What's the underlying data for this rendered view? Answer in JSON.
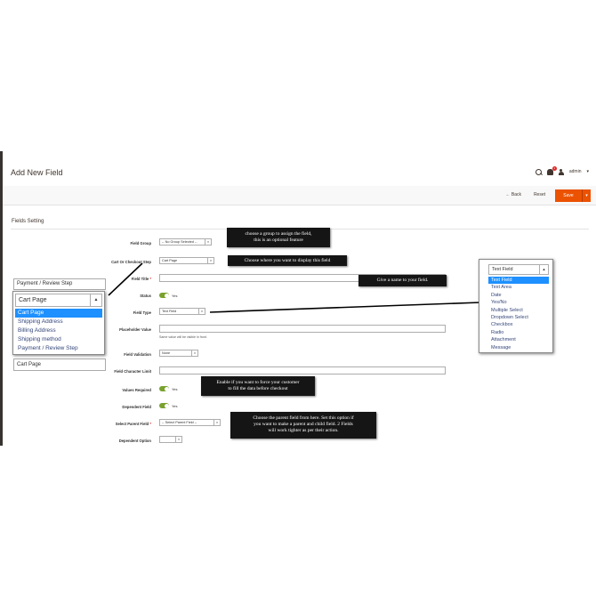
{
  "header": {
    "title": "Add New Field",
    "user": "admin",
    "user_caret": "▾",
    "notif_count": "1"
  },
  "actionbar": {
    "back": "Back",
    "back_arrow": "←",
    "reset": "Reset",
    "save": "Save",
    "save_arrow": "▾"
  },
  "section": {
    "title": "Fields Setting"
  },
  "form": {
    "field_group": {
      "label": "Field Group",
      "value": "-- No Group Selected --"
    },
    "cart_step": {
      "label": "Cart Or Checkout Step",
      "value": "Cart Page"
    },
    "field_title": {
      "label": "Field Title",
      "required": "*"
    },
    "status": {
      "label": "Status",
      "value": "Yes"
    },
    "field_type": {
      "label": "Field Type",
      "value": "Text Field"
    },
    "placeholder": {
      "label": "Placeholder Value",
      "note": "Same value will be visible in front."
    },
    "validation": {
      "label": "Field Validation",
      "value": "None"
    },
    "char_limit": {
      "label": "Field Character Limit"
    },
    "values_required": {
      "label": "Values Required",
      "value": "Yes"
    },
    "dependent_field": {
      "label": "Dependent Field",
      "value": "Yes"
    },
    "parent_field": {
      "label": "Select Parent Field",
      "required": "*",
      "value": "-- Select Parent Field --"
    },
    "dependent_option": {
      "label": "Dependent Option"
    }
  },
  "tooltips": {
    "group": [
      "choose a group to assign the field,",
      "this is an optional feature"
    ],
    "step": [
      "Choose where you want to display this field"
    ],
    "name": [
      "Give a name to your field."
    ],
    "required": [
      "Enable if you want to force your customer",
      "to fill the data before checkout"
    ],
    "parent": [
      "Choose the parent field from here. Set this option if",
      "you want to make a parent and child field. 2 Fields",
      "will work tighter as per their action."
    ]
  },
  "left_dropdown": {
    "selected": "Cart Page",
    "fragment_top": "Payment / Review Step",
    "fragment_bottom": "Cart Page",
    "options": [
      "Cart Page",
      "Shipping Address",
      "Billing Address",
      "Shipping method",
      "Payment / Review Step"
    ],
    "highlighted": 0
  },
  "right_dropdown": {
    "selected": "Text Field",
    "options": [
      "Text Field",
      "Text Area",
      "Date",
      "Yes/No",
      "Multiple Select",
      "Dropdown Select",
      "Checkbox",
      "Radio",
      "Attachment",
      "Message"
    ],
    "highlighted": 0
  },
  "colors": {
    "accent": "#eb5202",
    "toggle_on": "#79a22e",
    "highlight": "#1e90ff",
    "tooltip_bg": "#151515"
  },
  "icons": {
    "search": "search-icon",
    "bell": "bell-icon",
    "user": "user-icon",
    "dropdown": "chevron-down-icon",
    "scroll_up": "chevron-up-icon"
  }
}
